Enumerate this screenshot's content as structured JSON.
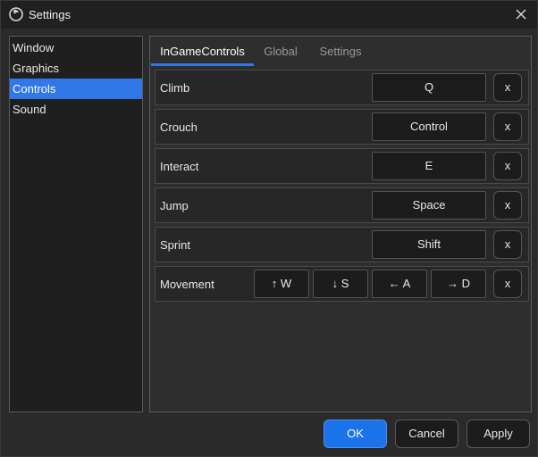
{
  "window": {
    "title": "Settings"
  },
  "sidebar": {
    "items": [
      {
        "label": "Window"
      },
      {
        "label": "Graphics"
      },
      {
        "label": "Controls",
        "selected": true
      },
      {
        "label": "Sound"
      }
    ]
  },
  "tabs": [
    {
      "label": "InGameControls",
      "active": true
    },
    {
      "label": "Global"
    },
    {
      "label": "Settings"
    }
  ],
  "bindings": [
    {
      "action": "Climb",
      "key": "Q",
      "clear": "x"
    },
    {
      "action": "Crouch",
      "key": "Control",
      "clear": "x"
    },
    {
      "action": "Interact",
      "key": "E",
      "clear": "x"
    },
    {
      "action": "Jump",
      "key": "Space",
      "clear": "x"
    },
    {
      "action": "Sprint",
      "key": "Shift",
      "clear": "x"
    }
  ],
  "movement": {
    "action": "Movement",
    "keys": [
      "↑ W",
      "↓ S",
      "← A",
      "→ D"
    ],
    "clear": "x"
  },
  "footer": {
    "ok": "OK",
    "cancel": "Cancel",
    "apply": "Apply"
  },
  "colors": {
    "accent": "#3077e8",
    "primary_button": "#1a73e8"
  }
}
